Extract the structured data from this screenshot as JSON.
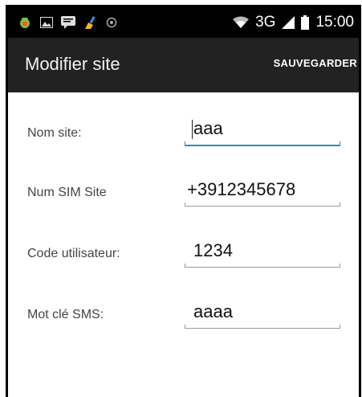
{
  "status_bar": {
    "network": "3G",
    "time": "15:00",
    "icons": [
      "android-debug-icon",
      "image-icon",
      "chat-icon",
      "broom-icon",
      "circle-icon",
      "wifi-icon",
      "signal-icon",
      "battery-icon"
    ]
  },
  "action_bar": {
    "title": "Modifier site",
    "save_label": "SAUVEGARDER"
  },
  "form": {
    "fields": [
      {
        "label": "Nom site:",
        "value": "aaa",
        "focused": true
      },
      {
        "label": "Num SIM Site",
        "value": "+3912345678",
        "focused": false
      },
      {
        "label": "Code utilisateur:",
        "value": "1234",
        "focused": false
      },
      {
        "label": "Mot clé SMS:",
        "value": "aaaa",
        "focused": false
      }
    ]
  },
  "colors": {
    "status_bar": "#000000",
    "action_bar": "#222222",
    "focus_underline": "#2a8fbd",
    "underline": "#9a9a9a"
  }
}
